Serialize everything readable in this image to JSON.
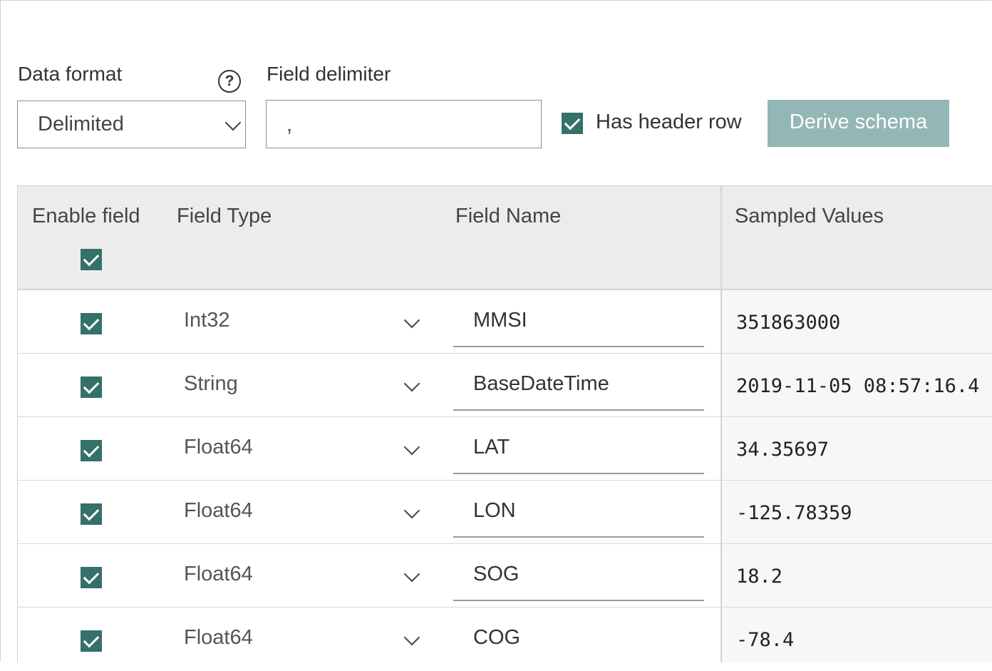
{
  "data_format": {
    "label": "Data format",
    "value": "Delimited",
    "help_icon": "help-icon"
  },
  "field_delimiter": {
    "label": "Field delimiter",
    "value": ","
  },
  "has_header_row": {
    "label": "Has header row",
    "checked": true
  },
  "derive_button": {
    "label": "Derive schema"
  },
  "table": {
    "headers": {
      "enable": "Enable field",
      "type": "Field Type",
      "name": "Field Name",
      "sampled": "Sampled Values"
    },
    "rows": [
      {
        "enabled": true,
        "type": "Int32",
        "name": "MMSI",
        "sample": "351863000"
      },
      {
        "enabled": true,
        "type": "String",
        "name": "BaseDateTime",
        "sample": "2019-11-05 08:57:16.4"
      },
      {
        "enabled": true,
        "type": "Float64",
        "name": "LAT",
        "sample": "34.35697"
      },
      {
        "enabled": true,
        "type": "Float64",
        "name": "LON",
        "sample": "-125.78359"
      },
      {
        "enabled": true,
        "type": "Float64",
        "name": "SOG",
        "sample": "18.2"
      },
      {
        "enabled": true,
        "type": "Float64",
        "name": "COG",
        "sample": "-78.4"
      }
    ]
  },
  "colors": {
    "accent": "#35706a",
    "button_disabled": "#93b7b5"
  }
}
